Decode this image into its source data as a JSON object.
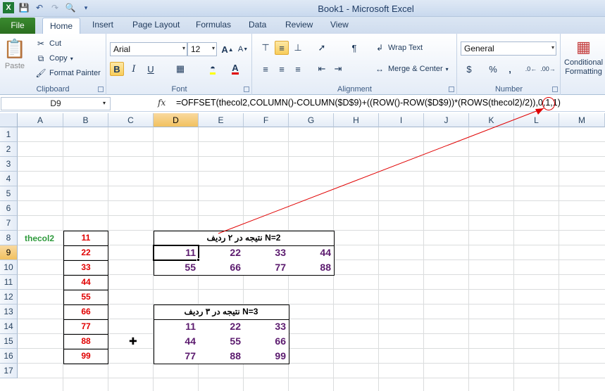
{
  "window": {
    "title": "Book1 - Microsoft Excel"
  },
  "tabs": {
    "file": "File",
    "items": [
      "Home",
      "Insert",
      "Page Layout",
      "Formulas",
      "Data",
      "Review",
      "View"
    ]
  },
  "ribbon": {
    "clipboard": {
      "label": "Clipboard",
      "paste": "Paste",
      "cut": "Cut",
      "copy": "Copy",
      "format_painter": "Format Painter"
    },
    "font": {
      "label": "Font",
      "name": "Arial",
      "size": "12",
      "bold": "B",
      "italic": "I",
      "underline": "U"
    },
    "alignment": {
      "label": "Alignment",
      "wrap": "Wrap Text",
      "merge": "Merge & Center"
    },
    "number": {
      "label": "Number",
      "format": "General",
      "currency": "$",
      "percent": "%",
      "comma": ","
    },
    "styles": {
      "conditional_1": "Conditional",
      "conditional_2": "Formatting"
    }
  },
  "formula_bar": {
    "name_box": "D9",
    "fx": "fx",
    "formula": "=OFFSET(thecol2,COLUMN()-COLUMN($D$9)+((ROW()-ROW($D$9))*(ROWS(thecol2)/2)),0,1,1)"
  },
  "sheet": {
    "columns": [
      "A",
      "B",
      "C",
      "D",
      "E",
      "F",
      "G",
      "H",
      "I",
      "J",
      "K",
      "L",
      "M"
    ],
    "rows": [
      "1",
      "2",
      "3",
      "4",
      "5",
      "6",
      "7",
      "8",
      "9",
      "10",
      "11",
      "12",
      "13",
      "14",
      "15",
      "16",
      "17"
    ],
    "selected_col": "D",
    "selected_row": "9",
    "range_name": "thecol2",
    "col_b_values": [
      "11",
      "22",
      "33",
      "44",
      "55",
      "66",
      "77",
      "88",
      "99"
    ],
    "table1": {
      "header": "N=2 نتیجه در ۲ ردیف",
      "rows": [
        [
          "11",
          "22",
          "33",
          "44"
        ],
        [
          "55",
          "66",
          "77",
          "88"
        ]
      ]
    },
    "table2": {
      "header": "N=3 نتیجه در ۳ ردیف",
      "rows": [
        [
          "11",
          "22",
          "33"
        ],
        [
          "44",
          "55",
          "66"
        ],
        [
          "77",
          "88",
          "99"
        ]
      ]
    }
  },
  "colors": {
    "accent_red": "#e00000",
    "values_purple": "#5b1a6e",
    "name_green": "#2e9a3c",
    "file_tab": "#2a6e1f"
  }
}
